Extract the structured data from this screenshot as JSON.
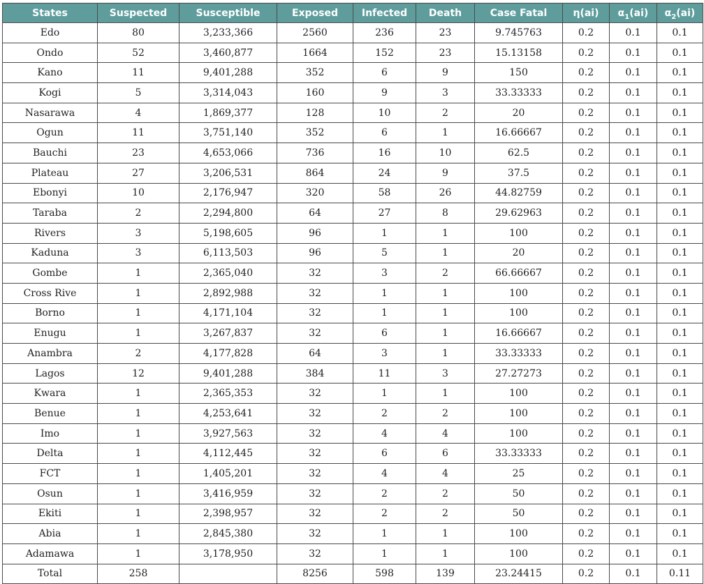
{
  "table": {
    "headers": [
      {
        "text": "States"
      },
      {
        "text": "Suspected"
      },
      {
        "text": "Susceptible"
      },
      {
        "text": "Exposed"
      },
      {
        "text": "Infected"
      },
      {
        "text": "Death"
      },
      {
        "text": "Case Fatal"
      },
      {
        "text": "η(ai)"
      },
      {
        "base": "α",
        "sub": "1",
        "rest": "(ai)"
      },
      {
        "base": "α",
        "sub": "2",
        "rest": "(ai)"
      }
    ],
    "rows": [
      [
        "Edo",
        "80",
        "3,233,366",
        "2560",
        "236",
        "23",
        "9.745763",
        "0.2",
        "0.1",
        "0.1"
      ],
      [
        "Ondo",
        "52",
        "3,460,877",
        "1664",
        "152",
        "23",
        "15.13158",
        "0.2",
        "0.1",
        "0.1"
      ],
      [
        "Kano",
        "11",
        "9,401,288",
        "352",
        "6",
        "9",
        "150",
        "0.2",
        "0.1",
        "0.1"
      ],
      [
        "Kogi",
        "5",
        "3,314,043",
        "160",
        "9",
        "3",
        "33.33333",
        "0.2",
        "0.1",
        "0.1"
      ],
      [
        "Nasarawa",
        "4",
        "1,869,377",
        "128",
        "10",
        "2",
        "20",
        "0.2",
        "0.1",
        "0.1"
      ],
      [
        "Ogun",
        "11",
        "3,751,140",
        "352",
        "6",
        "1",
        "16.66667",
        "0.2",
        "0.1",
        "0.1"
      ],
      [
        "Bauchi",
        "23",
        "4,653,066",
        "736",
        "16",
        "10",
        "62.5",
        "0.2",
        "0.1",
        "0.1"
      ],
      [
        "Plateau",
        "27",
        "3,206,531",
        "864",
        "24",
        "9",
        "37.5",
        "0.2",
        "0.1",
        "0.1"
      ],
      [
        "Ebonyi",
        "10",
        "2,176,947",
        "320",
        "58",
        "26",
        "44.82759",
        "0.2",
        "0.1",
        "0.1"
      ],
      [
        "Taraba",
        "2",
        "2,294,800",
        "64",
        "27",
        "8",
        "29.62963",
        "0.2",
        "0.1",
        "0.1"
      ],
      [
        "Rivers",
        "3",
        "5,198,605",
        "96",
        "1",
        "1",
        "100",
        "0.2",
        "0.1",
        "0.1"
      ],
      [
        "Kaduna",
        "3",
        "6,113,503",
        "96",
        "5",
        "1",
        "20",
        "0.2",
        "0.1",
        "0.1"
      ],
      [
        "Gombe",
        "1",
        "2,365,040",
        "32",
        "3",
        "2",
        "66.66667",
        "0.2",
        "0.1",
        "0.1"
      ],
      [
        "Cross Rive",
        "1",
        "2,892,988",
        "32",
        "1",
        "1",
        "100",
        "0.2",
        "0.1",
        "0.1"
      ],
      [
        "Borno",
        "1",
        "4,171,104",
        "32",
        "1",
        "1",
        "100",
        "0.2",
        "0.1",
        "0.1"
      ],
      [
        "Enugu",
        "1",
        "3,267,837",
        "32",
        "6",
        "1",
        "16.66667",
        "0.2",
        "0.1",
        "0.1"
      ],
      [
        "Anambra",
        "2",
        "4,177,828",
        "64",
        "3",
        "1",
        "33.33333",
        "0.2",
        "0.1",
        "0.1"
      ],
      [
        "Lagos",
        "12",
        "9,401,288",
        "384",
        "11",
        "3",
        "27.27273",
        "0.2",
        "0.1",
        "0.1"
      ],
      [
        "Kwara",
        "1",
        "2,365,353",
        "32",
        "1",
        "1",
        "100",
        "0.2",
        "0.1",
        "0.1"
      ],
      [
        "Benue",
        "1",
        "4,253,641",
        "32",
        "2",
        "2",
        "100",
        "0.2",
        "0.1",
        "0.1"
      ],
      [
        "Imo",
        "1",
        "3,927,563",
        "32",
        "4",
        "4",
        "100",
        "0.2",
        "0.1",
        "0.1"
      ],
      [
        "Delta",
        "1",
        "4,112,445",
        "32",
        "6",
        "6",
        "33.33333",
        "0.2",
        "0.1",
        "0.1"
      ],
      [
        "FCT",
        "1",
        "1,405,201",
        "32",
        "4",
        "4",
        "25",
        "0.2",
        "0.1",
        "0.1"
      ],
      [
        "Osun",
        "1",
        "3,416,959",
        "32",
        "2",
        "2",
        "50",
        "0.2",
        "0.1",
        "0.1"
      ],
      [
        "Ekiti",
        "1",
        "2,398,957",
        "32",
        "2",
        "2",
        "50",
        "0.2",
        "0.1",
        "0.1"
      ],
      [
        "Abia",
        "1",
        "2,845,380",
        "32",
        "1",
        "1",
        "100",
        "0.2",
        "0.1",
        "0.1"
      ],
      [
        "Adamawa",
        "1",
        "3,178,950",
        "32",
        "1",
        "1",
        "100",
        "0.2",
        "0.1",
        "0.1"
      ],
      [
        "Total",
        "258",
        "",
        "8256",
        "598",
        "139",
        "23.24415",
        "0.2",
        "0.1",
        "0.11"
      ]
    ]
  },
  "colors": {
    "header_bg": "#5f9d9d",
    "header_text": "#ffffff",
    "border": "#4a4a4a",
    "cell_text": "#222222"
  }
}
